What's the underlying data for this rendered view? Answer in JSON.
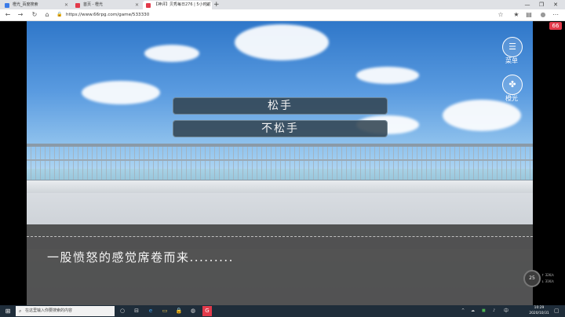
{
  "browser": {
    "tabs": [
      {
        "title": "橙光_百度搜索",
        "favicon_color": "#3b7be8",
        "active": false
      },
      {
        "title": "首页 - 橙光",
        "favicon_color": "#e23a4a",
        "active": false
      },
      {
        "title": "【神评】贝秀每日276 | 5小时前",
        "favicon_color": "#e23a4a",
        "active": true
      }
    ],
    "new_tab": "+",
    "window_controls": {
      "minimize": "—",
      "restore": "❐",
      "close": "✕"
    },
    "url": "https://www.66rpg.com/game/533330",
    "nav": {
      "back": "←",
      "forward": "→",
      "reload": "↻",
      "home": "⌂"
    },
    "toolbar_icons": {
      "star": "☆",
      "favorites": "★",
      "collections": "▤",
      "profile": "●",
      "more": "⋯"
    }
  },
  "game": {
    "choices": [
      "松手",
      "不松手"
    ],
    "menu_label": "菜单",
    "orange_label": "橙光",
    "dialogue": "一股愤怒的感觉席卷而来.........",
    "logo": "66",
    "network": {
      "percent": "25",
      "up": "↑ 32K/s",
      "down": "↓ 31K/s"
    }
  },
  "taskbar": {
    "start": "⊞",
    "search_placeholder": "在这里输入你要搜索的内容",
    "apps": [
      "○",
      "⊟",
      "e",
      "▭",
      "🔒",
      "◍",
      "G"
    ],
    "tray": [
      "^",
      "☁",
      "■",
      "♪",
      "中"
    ],
    "time": "10:29",
    "date": "2020/10/31"
  },
  "colors": {
    "accent": "#e23a4a",
    "choice_bg": "#324452",
    "taskbar": "#1f2d3a"
  }
}
